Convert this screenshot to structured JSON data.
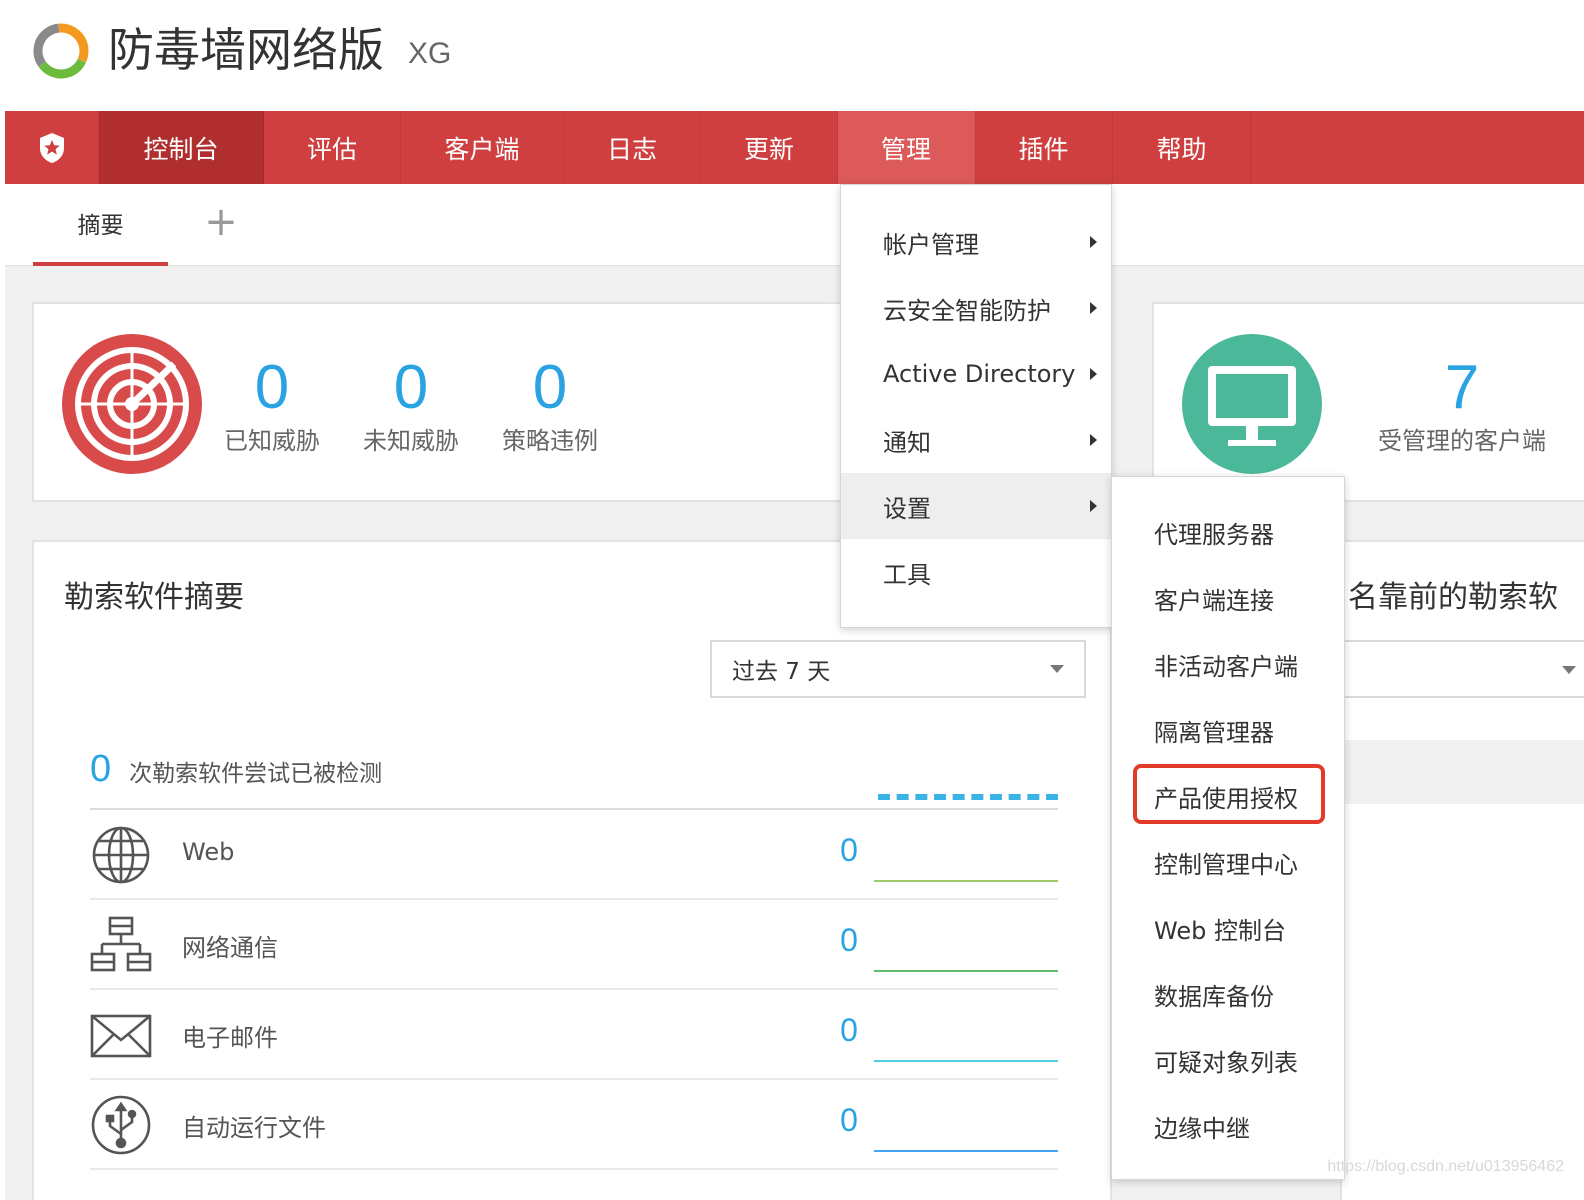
{
  "app": {
    "title": "防毒墙网络版",
    "edition": "XG"
  },
  "nav": {
    "home_icon": "shield-star-icon",
    "items": [
      {
        "label": "控制台",
        "state": "active"
      },
      {
        "label": "评估",
        "state": ""
      },
      {
        "label": "客户端",
        "state": ""
      },
      {
        "label": "日志",
        "state": ""
      },
      {
        "label": "更新",
        "state": ""
      },
      {
        "label": "管理",
        "state": "open"
      },
      {
        "label": "插件",
        "state": ""
      },
      {
        "label": "帮助",
        "state": ""
      }
    ]
  },
  "subtabs": {
    "summary": "摘要",
    "add": "+"
  },
  "threats": {
    "icon": "radar-icon",
    "stats": [
      {
        "value": "0",
        "label": "已知威胁"
      },
      {
        "value": "0",
        "label": "未知威胁"
      },
      {
        "value": "0",
        "label": "策略违例"
      }
    ]
  },
  "clients": {
    "icon": "monitor-icon",
    "value": "7",
    "label": "受管理的客户端"
  },
  "ransomware": {
    "title": "勒索软件摘要",
    "range": "过去 7 天",
    "detected_count": "0",
    "detected_text": "次勒索软件尝试已被检测",
    "vectors": [
      {
        "name": "Web",
        "count": "0",
        "icon": "globe-icon",
        "color": "#9ccc65"
      },
      {
        "name": "网络通信",
        "count": "0",
        "icon": "network-icon",
        "color": "#66bb6a"
      },
      {
        "name": "电子邮件",
        "count": "0",
        "icon": "envelope-icon",
        "color": "#4dd0e1"
      },
      {
        "name": "自动运行文件",
        "count": "0",
        "icon": "usb-icon",
        "color": "#42a5f5"
      }
    ]
  },
  "top_ransomware": {
    "title": "名靠前的勒索软"
  },
  "admin_menu": {
    "items": [
      {
        "label": "帐户管理",
        "has_sub": true
      },
      {
        "label": "云安全智能防护",
        "has_sub": true
      },
      {
        "label": "Active Directory",
        "has_sub": true
      },
      {
        "label": "通知",
        "has_sub": true
      },
      {
        "label": "设置",
        "has_sub": true
      },
      {
        "label": "工具",
        "has_sub": false
      }
    ]
  },
  "settings_menu": {
    "items": [
      "代理服务器",
      "客户端连接",
      "非活动客户端",
      "隔离管理器",
      "产品使用授权",
      "控制管理中心",
      "Web 控制台",
      "数据库备份",
      "可疑对象列表",
      "边缘中继"
    ],
    "highlighted": "产品使用授权"
  },
  "watermark": "https://blog.csdn.net/u013956462",
  "colors": {
    "nav_bg": "#cf3f3f",
    "nav_active": "#b02e2e",
    "accent_blue": "#2aa3e3",
    "radar_red": "#d94b4b",
    "monitor_green": "#4cb89a",
    "highlight_red": "#e23b2a"
  }
}
